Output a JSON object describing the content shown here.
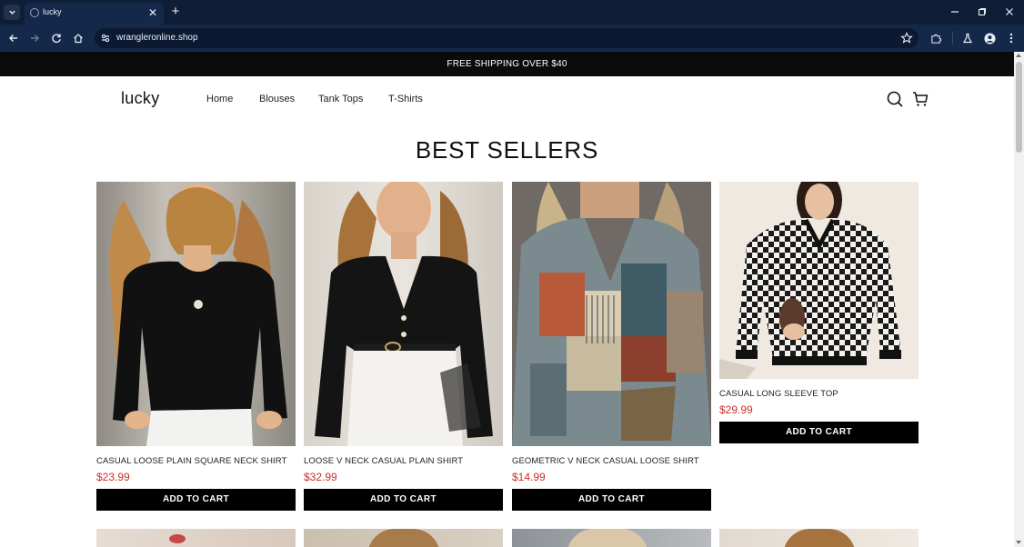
{
  "browser": {
    "tab_title": "lucky",
    "url": "wrangleronline.shop"
  },
  "announcement": "FREE SHIPPING OVER $40",
  "site": {
    "logo": "lucky",
    "nav": [
      "Home",
      "Blouses",
      "Tank Tops",
      "T-Shirts"
    ]
  },
  "section_title": "BEST SELLERS",
  "products": [
    {
      "name": "CASUAL LOOSE PLAIN SQUARE NECK SHIRT",
      "price": "$23.99",
      "button": "ADD TO CART"
    },
    {
      "name": "LOOSE V NECK CASUAL PLAIN SHIRT",
      "price": "$32.99",
      "button": "ADD TO CART"
    },
    {
      "name": "GEOMETRIC V NECK CASUAL LOOSE SHIRT",
      "price": "$14.99",
      "button": "ADD TO CART"
    },
    {
      "name": "CASUAL LONG SLEEVE TOP",
      "price": "$29.99",
      "button": "ADD TO CART"
    }
  ],
  "icons": {
    "tab_list": "chevron-down-icon",
    "tab_favicon": "globe-icon",
    "tab_close": "close-icon",
    "new_tab": "plus-icon",
    "back": "arrow-left-icon",
    "forward": "arrow-right-icon",
    "reload": "reload-icon",
    "home": "home-icon",
    "site_info": "tune-icon",
    "bookmark": "star-icon",
    "extensions": "puzzle-icon",
    "labs": "flask-icon",
    "profile": "person-icon",
    "menu": "kebab-menu-icon",
    "search": "search-icon",
    "cart": "cart-icon"
  },
  "colors": {
    "browser_frame": "#0f1e36",
    "announcement_bar": "#0b0b0b",
    "price": "#c9302c",
    "button": "#000000"
  }
}
